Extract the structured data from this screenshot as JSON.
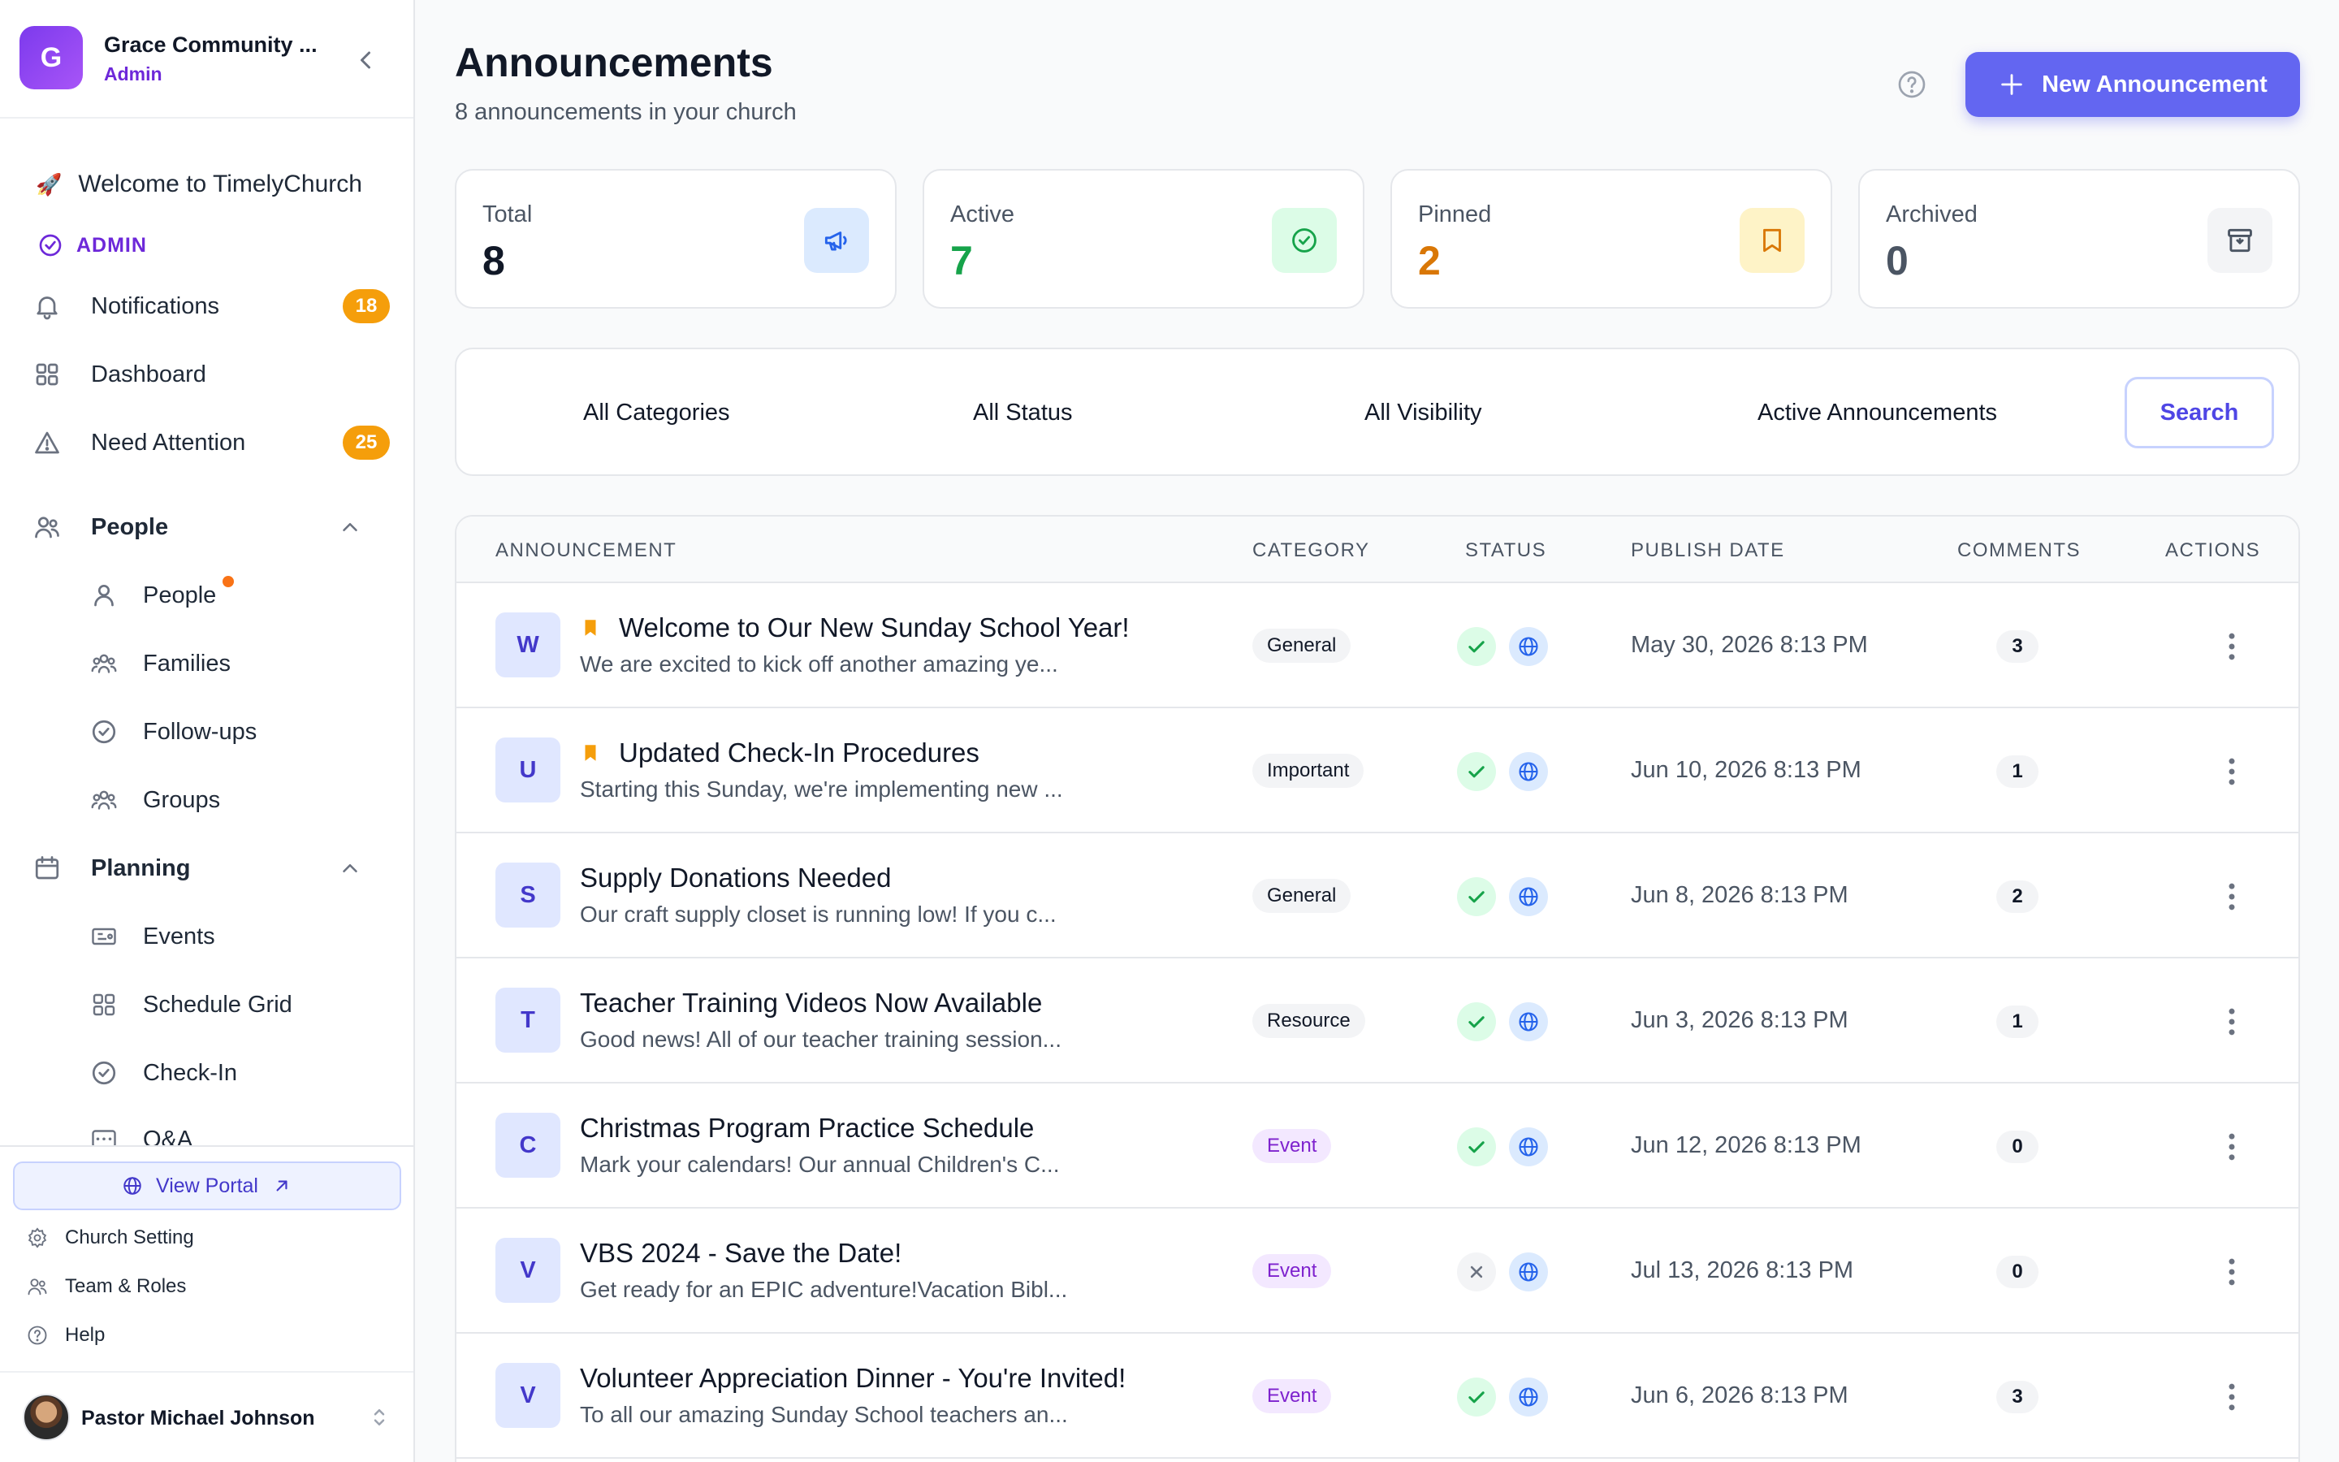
{
  "sidebar": {
    "logo_letter": "G",
    "church_name": "Grace Community ...",
    "church_role": "Admin",
    "welcome": "Welcome to TimelyChurch",
    "admin_label": "ADMIN",
    "items": [
      {
        "label": "Notifications",
        "badge": "18"
      },
      {
        "label": "Dashboard"
      },
      {
        "label": "Need Attention",
        "badge": "25"
      }
    ],
    "people_section": {
      "label": "People",
      "items": [
        "People",
        "Families",
        "Follow-ups",
        "Groups"
      ]
    },
    "planning_section": {
      "label": "Planning",
      "items": [
        "Events",
        "Schedule Grid",
        "Check-In",
        "Q&A"
      ]
    },
    "footer": {
      "portal": "View Portal",
      "links": [
        "Church Setting",
        "Team & Roles",
        "Help"
      ],
      "user_name": "Pastor Michael Johnson"
    }
  },
  "header": {
    "title": "Announcements",
    "subtitle": "8 announcements in your church",
    "new_button": "New Announcement"
  },
  "stats": [
    {
      "label": "Total",
      "value": "8",
      "color": "#111827",
      "icon": "megaphone-icon",
      "icon_bg": "#dbeafe",
      "icon_color": "#2563eb"
    },
    {
      "label": "Active",
      "value": "7",
      "color": "#16a34a",
      "icon": "check-circle-icon",
      "icon_bg": "#dcfce7",
      "icon_color": "#16a34a"
    },
    {
      "label": "Pinned",
      "value": "2",
      "color": "#d97706",
      "icon": "bookmark-icon",
      "icon_bg": "#fef3c7",
      "icon_color": "#d97706"
    },
    {
      "label": "Archived",
      "value": "0",
      "color": "#4b5563",
      "icon": "archive-icon",
      "icon_bg": "#f3f4f6",
      "icon_color": "#4b5563"
    }
  ],
  "filters": {
    "categories": "All Categories",
    "status": "All Status",
    "visibility": "All Visibility",
    "active": "Active Announcements",
    "search_button": "Search"
  },
  "table": {
    "columns": [
      "ANNOUNCEMENT",
      "CATEGORY",
      "STATUS",
      "PUBLISH DATE",
      "COMMENTS",
      "ACTIONS"
    ],
    "rows": [
      {
        "initial": "W",
        "pinned": true,
        "title": "Welcome to Our New Sunday School Year!",
        "excerpt": "We are excited to kick off another amazing ye...",
        "category": "General",
        "cat_style": "gray",
        "active": true,
        "date": "May 30, 2026 8:13 PM",
        "comments": "3"
      },
      {
        "initial": "U",
        "pinned": true,
        "title": "Updated Check-In Procedures",
        "excerpt": "Starting this Sunday, we're implementing new ...",
        "category": "Important",
        "cat_style": "gray",
        "active": true,
        "date": "Jun 10, 2026 8:13 PM",
        "comments": "1"
      },
      {
        "initial": "S",
        "pinned": false,
        "title": "Supply Donations Needed",
        "excerpt": "Our craft supply closet is running low! If you c...",
        "category": "General",
        "cat_style": "gray",
        "active": true,
        "date": "Jun 8, 2026 8:13 PM",
        "comments": "2"
      },
      {
        "initial": "T",
        "pinned": false,
        "title": "Teacher Training Videos Now Available",
        "excerpt": "Good news! All of our teacher training session...",
        "category": "Resource",
        "cat_style": "gray",
        "active": true,
        "date": "Jun 3, 2026 8:13 PM",
        "comments": "1"
      },
      {
        "initial": "C",
        "pinned": false,
        "title": "Christmas Program Practice Schedule",
        "excerpt": "Mark your calendars! Our annual Children's C...",
        "category": "Event",
        "cat_style": "purple",
        "active": true,
        "date": "Jun 12, 2026 8:13 PM",
        "comments": "0"
      },
      {
        "initial": "V",
        "pinned": false,
        "title": "VBS 2024 - Save the Date!",
        "excerpt": "Get ready for an EPIC adventure!Vacation Bibl...",
        "category": "Event",
        "cat_style": "purple",
        "active": false,
        "date": "Jul 13, 2026 8:13 PM",
        "comments": "0"
      },
      {
        "initial": "V",
        "pinned": false,
        "title": "Volunteer Appreciation Dinner - You're Invited!",
        "excerpt": "To all our amazing Sunday School teachers an...",
        "category": "Event",
        "cat_style": "purple",
        "active": true,
        "date": "Jun 6, 2026 8:13 PM",
        "comments": "3"
      }
    ]
  }
}
